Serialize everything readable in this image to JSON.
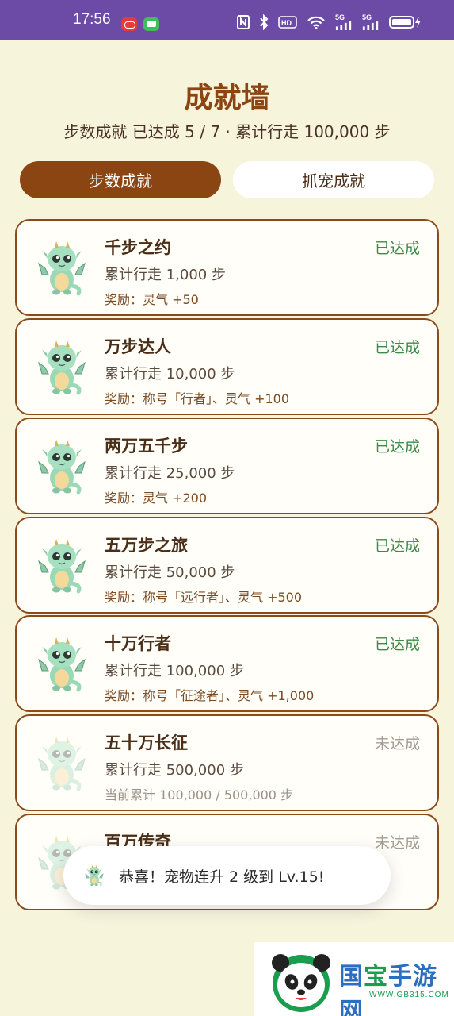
{
  "status_bar": {
    "time": "17:56",
    "net_label_1": "5G",
    "net_label_2": "5G",
    "hd_label": "HD",
    "icons": [
      "nfc-icon",
      "bluetooth-icon",
      "hd-icon",
      "wifi-icon",
      "signal-icon",
      "signal-icon",
      "battery-icon"
    ]
  },
  "header": {
    "title": "成就墙",
    "summary": "步数成就 已达成 5 / 7 · 累计行走 100,000 步"
  },
  "tabs": [
    {
      "label": "步数成就",
      "active": true
    },
    {
      "label": "抓宠成就",
      "active": false
    }
  ],
  "achievements": [
    {
      "title": "千步之约",
      "desc": "累计行走 1,000 步",
      "reward": "奖励：灵气 +50",
      "status": "已达成",
      "achieved": true
    },
    {
      "title": "万步达人",
      "desc": "累计行走 10,000 步",
      "reward": "奖励：称号「行者」、灵气 +100",
      "status": "已达成",
      "achieved": true
    },
    {
      "title": "两万五千步",
      "desc": "累计行走 25,000 步",
      "reward": "奖励：灵气 +200",
      "status": "已达成",
      "achieved": true
    },
    {
      "title": "五万步之旅",
      "desc": "累计行走 50,000 步",
      "reward": "奖励：称号「远行者」、灵气 +500",
      "status": "已达成",
      "achieved": true
    },
    {
      "title": "十万行者",
      "desc": "累计行走 100,000 步",
      "reward": "奖励：称号「征途者」、灵气 +1,000",
      "status": "已达成",
      "achieved": true
    },
    {
      "title": "五十万长征",
      "desc": "累计行走 500,000 步",
      "reward": "当前累计 100,000 / 500,000 步",
      "status": "未达成",
      "achieved": false
    },
    {
      "title": "百万传奇",
      "desc": "",
      "reward": "",
      "status": "未达成",
      "achieved": false
    }
  ],
  "toast": {
    "message": "恭喜！宠物连升 2 级到 Lv.15!"
  },
  "watermark": {
    "brand_part1": "国",
    "brand_part2": "宝",
    "brand_part3": "手游网",
    "url": "WWW.GB315.COM"
  },
  "colors": {
    "status_bar": "#6b4ba5",
    "background": "#f7f4dc",
    "accent_brown": "#8a4512",
    "achieved_green": "#3d8a47",
    "locked_gray": "#a39c95"
  }
}
